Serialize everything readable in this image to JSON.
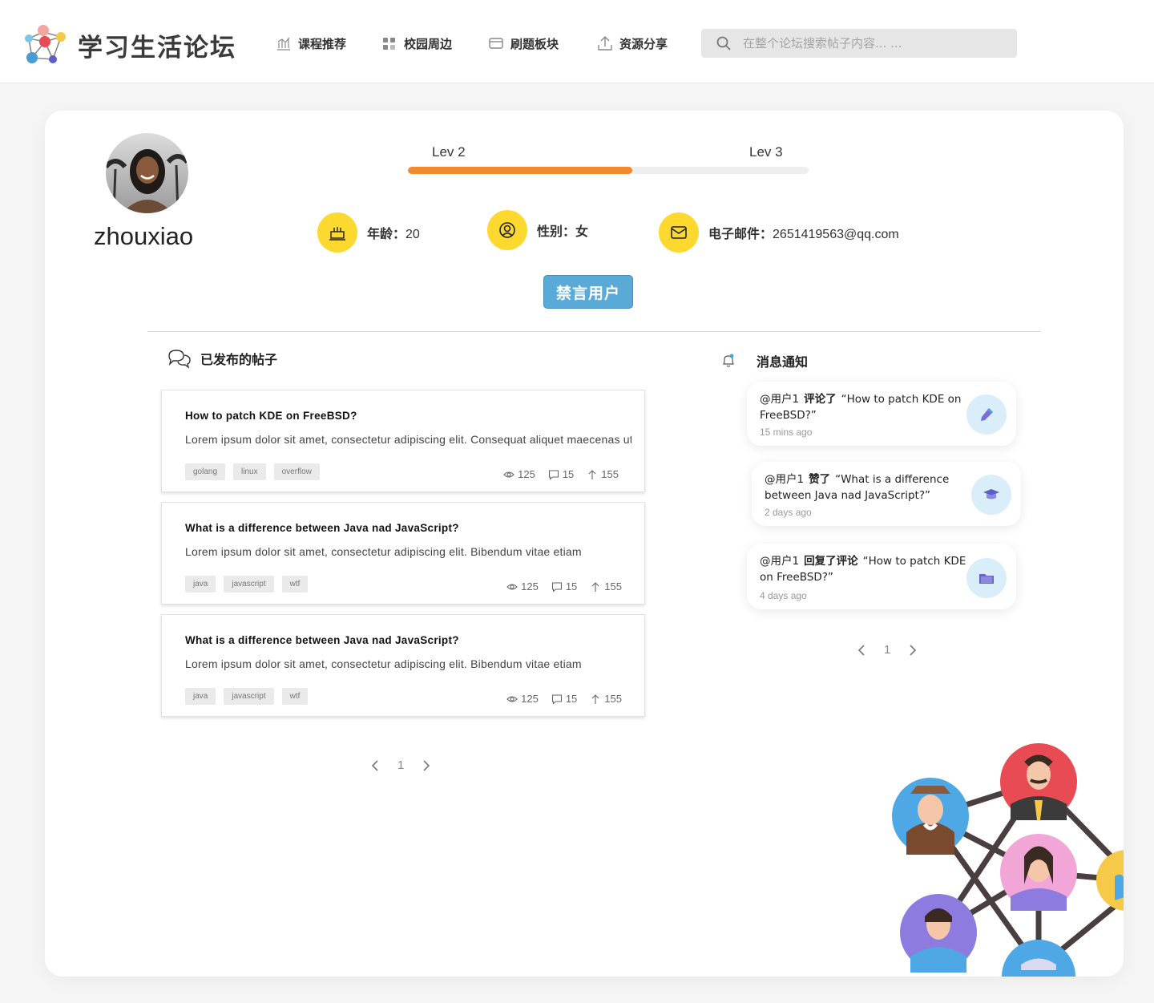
{
  "header": {
    "brand": "学习生活论坛",
    "nav": [
      {
        "label": "课程推荐",
        "icon": "bar-chart-icon"
      },
      {
        "label": "校园周边",
        "icon": "grid-icon"
      },
      {
        "label": "刷题板块",
        "icon": "card-icon"
      },
      {
        "label": "资源分享",
        "icon": "upload-icon"
      }
    ],
    "search_placeholder": "在整个论坛搜索帖子内容... ..."
  },
  "profile": {
    "username": "zhouxiao",
    "level_current": "Lev 2",
    "level_next": "Lev 3",
    "level_progress": 0.56,
    "age_label": "年龄：",
    "age": "20",
    "gender_label": "性别：",
    "gender": "女",
    "email_label": "电子邮件：",
    "email": "2651419563@qq.com",
    "ban_button": "禁言用户"
  },
  "posts_section": {
    "title": "已发布的帖子",
    "posts": [
      {
        "title": "How to patch KDE on FreeBSD?",
        "body": "Lorem ipsum dolor sit amet, consectetur adipiscing elit. Consequat aliquet maecenas ut sit nulla",
        "tags": [
          "golang",
          "linux",
          "overflow"
        ],
        "views": "125",
        "comments": "15",
        "votes": "155"
      },
      {
        "title": "What is a difference between Java nad JavaScript?",
        "body": "Lorem ipsum dolor sit amet, consectetur adipiscing elit. Bibendum vitae etiam",
        "tags": [
          "java",
          "javascript",
          "wtf"
        ],
        "views": "125",
        "comments": "15",
        "votes": "155"
      },
      {
        "title": "What is a difference between Java nad JavaScript?",
        "body": "Lorem ipsum dolor sit amet, consectetur adipiscing elit. Bibendum vitae etiam",
        "tags": [
          "java",
          "javascript",
          "wtf"
        ],
        "views": "125",
        "comments": "15",
        "votes": "155"
      }
    ],
    "page": "1"
  },
  "notifications_section": {
    "title": "消息通知",
    "items": [
      {
        "user": "@用户1",
        "action": "评论了",
        "text": "“How to patch KDE on FreeBSD?”",
        "time": "15 mins ago",
        "icon": "pencil-icon"
      },
      {
        "user": "@用户1",
        "action": "赞了",
        "text": "“What is a difference between Java nad JavaScript?”",
        "time": "2 days ago",
        "icon": "graduation-cap-icon"
      },
      {
        "user": "@用户1",
        "action": "回复了评论",
        "text": "“How to patch KDE on FreeBSD?”",
        "time": "4 days ago",
        "icon": "folder-icon"
      }
    ],
    "page": "1"
  },
  "colors": {
    "accent_orange": "#f08a2e",
    "icon_yellow": "#fdd92f",
    "ban_button_blue": "#5aaad8"
  }
}
